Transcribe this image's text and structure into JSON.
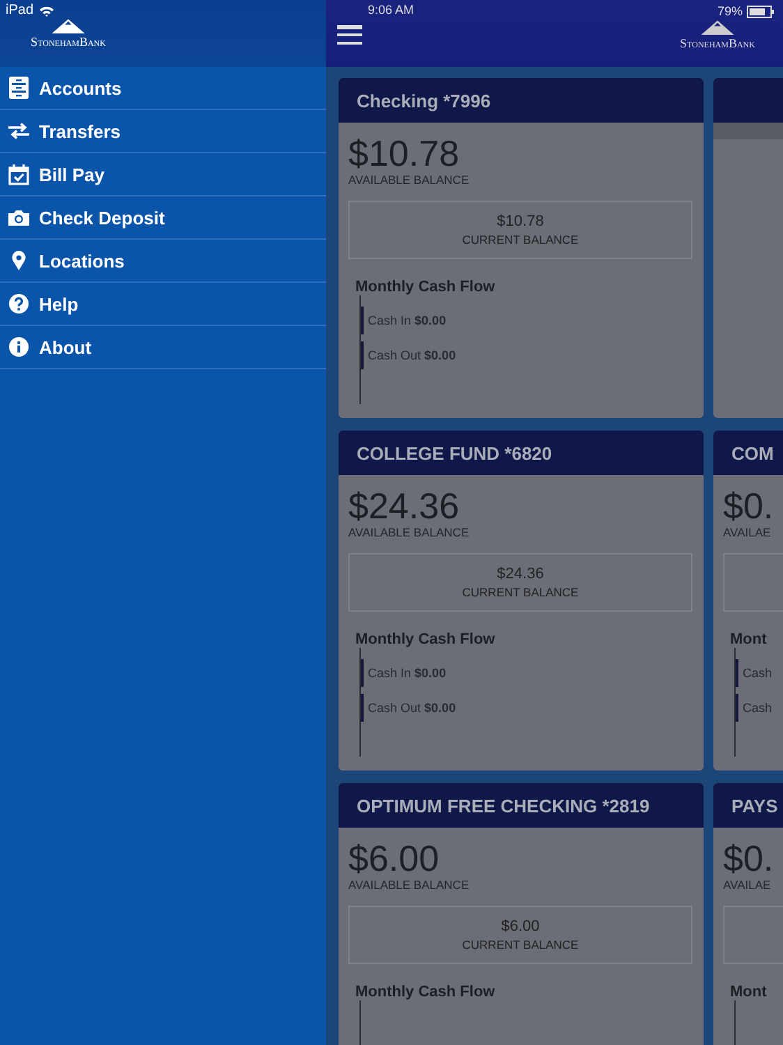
{
  "status_bar": {
    "device": "iPad",
    "time": "9:06 AM",
    "battery": "79%"
  },
  "sidebar": {
    "logo": "StonehamBank",
    "items": [
      {
        "label": "Accounts"
      },
      {
        "label": "Transfers"
      },
      {
        "label": "Bill Pay"
      },
      {
        "label": "Check Deposit"
      },
      {
        "label": "Locations"
      },
      {
        "label": "Help"
      },
      {
        "label": "About"
      }
    ]
  },
  "header": {
    "logo": "StonehamBank"
  },
  "account_rows": [
    [
      {
        "kind": "account",
        "name": "Checking *7996",
        "available": "$10.78",
        "available_label": "AVAILABLE BALANCE",
        "current": "$10.78",
        "current_label": "CURRENT BALANCE",
        "cashflow_title": "Monthly Cash Flow",
        "cash_in_label": "Cash In",
        "cash_in": "$0.00",
        "cash_out_label": "Cash Out",
        "cash_out": "$0.00"
      },
      {
        "kind": "blank"
      }
    ],
    [
      {
        "kind": "account",
        "name": "COLLEGE FUND *6820",
        "available": "$24.36",
        "available_label": "AVAILABLE BALANCE",
        "current": "$24.36",
        "current_label": "CURRENT BALANCE",
        "cashflow_title": "Monthly Cash Flow",
        "cash_in_label": "Cash In",
        "cash_in": "$0.00",
        "cash_out_label": "Cash Out",
        "cash_out": "$0.00"
      },
      {
        "kind": "account",
        "name": "COM",
        "available": "$0.",
        "available_label": "AVAILAE",
        "cashflow_title": "Mont",
        "cash_in_label": "Cash",
        "cash_out_label": "Cash"
      }
    ],
    [
      {
        "kind": "account",
        "name": "OPTIMUM FREE CHECKING *2819",
        "available": "$6.00",
        "available_label": "AVAILABLE BALANCE",
        "current": "$6.00",
        "current_label": "CURRENT BALANCE",
        "cashflow_title": "Monthly Cash Flow"
      },
      {
        "kind": "account",
        "name": "PAYS",
        "available": "$0.",
        "available_label": "AVAILAE",
        "cashflow_title": "Mont"
      }
    ]
  ]
}
